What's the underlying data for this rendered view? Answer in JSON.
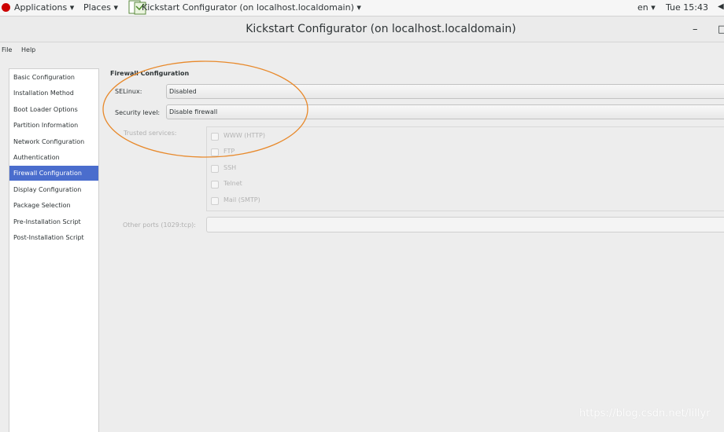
{
  "topbar": {
    "applications": "Applications ▾",
    "places": "Places ▾",
    "window_menu": "Kickstart Configurator (on localhost.localdomain) ▾",
    "language": "en ▾",
    "clock": "Tue 15:43",
    "icons": [
      "redhat-logo-icon",
      "kickstart-app-icon",
      "volume-icon"
    ]
  },
  "window": {
    "title": "Kickstart Configurator (on localhost.localdomain)",
    "minimize": "–",
    "maximize": "□"
  },
  "menubar": {
    "items": [
      "File",
      "Help"
    ]
  },
  "nav": {
    "items": [
      {
        "label": "Basic Configuration"
      },
      {
        "label": "Installation Method"
      },
      {
        "label": "Boot Loader Options"
      },
      {
        "label": "Partition Information"
      },
      {
        "label": "Network Configuration"
      },
      {
        "label": "Authentication"
      },
      {
        "label": "Firewall Configuration"
      },
      {
        "label": "Display Configuration"
      },
      {
        "label": "Package Selection"
      },
      {
        "label": "Pre-Installation Script"
      },
      {
        "label": "Post-Installation Script"
      }
    ],
    "selected": "Firewall Configuration"
  },
  "firewall": {
    "section_title": "Firewall Configuration",
    "selinux_label": "SELinux:",
    "selinux_value": "Disabled",
    "security_label": "Security level:",
    "security_value": "Disable firewall",
    "trusted_label": "Trusted services:",
    "services": [
      {
        "label": "WWW (HTTP)",
        "checked": false
      },
      {
        "label": "FTP",
        "checked": false
      },
      {
        "label": "SSH",
        "checked": false
      },
      {
        "label": "Telnet",
        "checked": false
      },
      {
        "label": "Mail (SMTP)",
        "checked": false
      }
    ],
    "other_ports_label": "Other ports (1029:tcp):",
    "other_ports_value": ""
  },
  "annotation": {
    "color": "#e8892b"
  },
  "watermark": "https://blog.csdn.net/lillyr",
  "colors": {
    "selection": "#4a6dcd"
  }
}
